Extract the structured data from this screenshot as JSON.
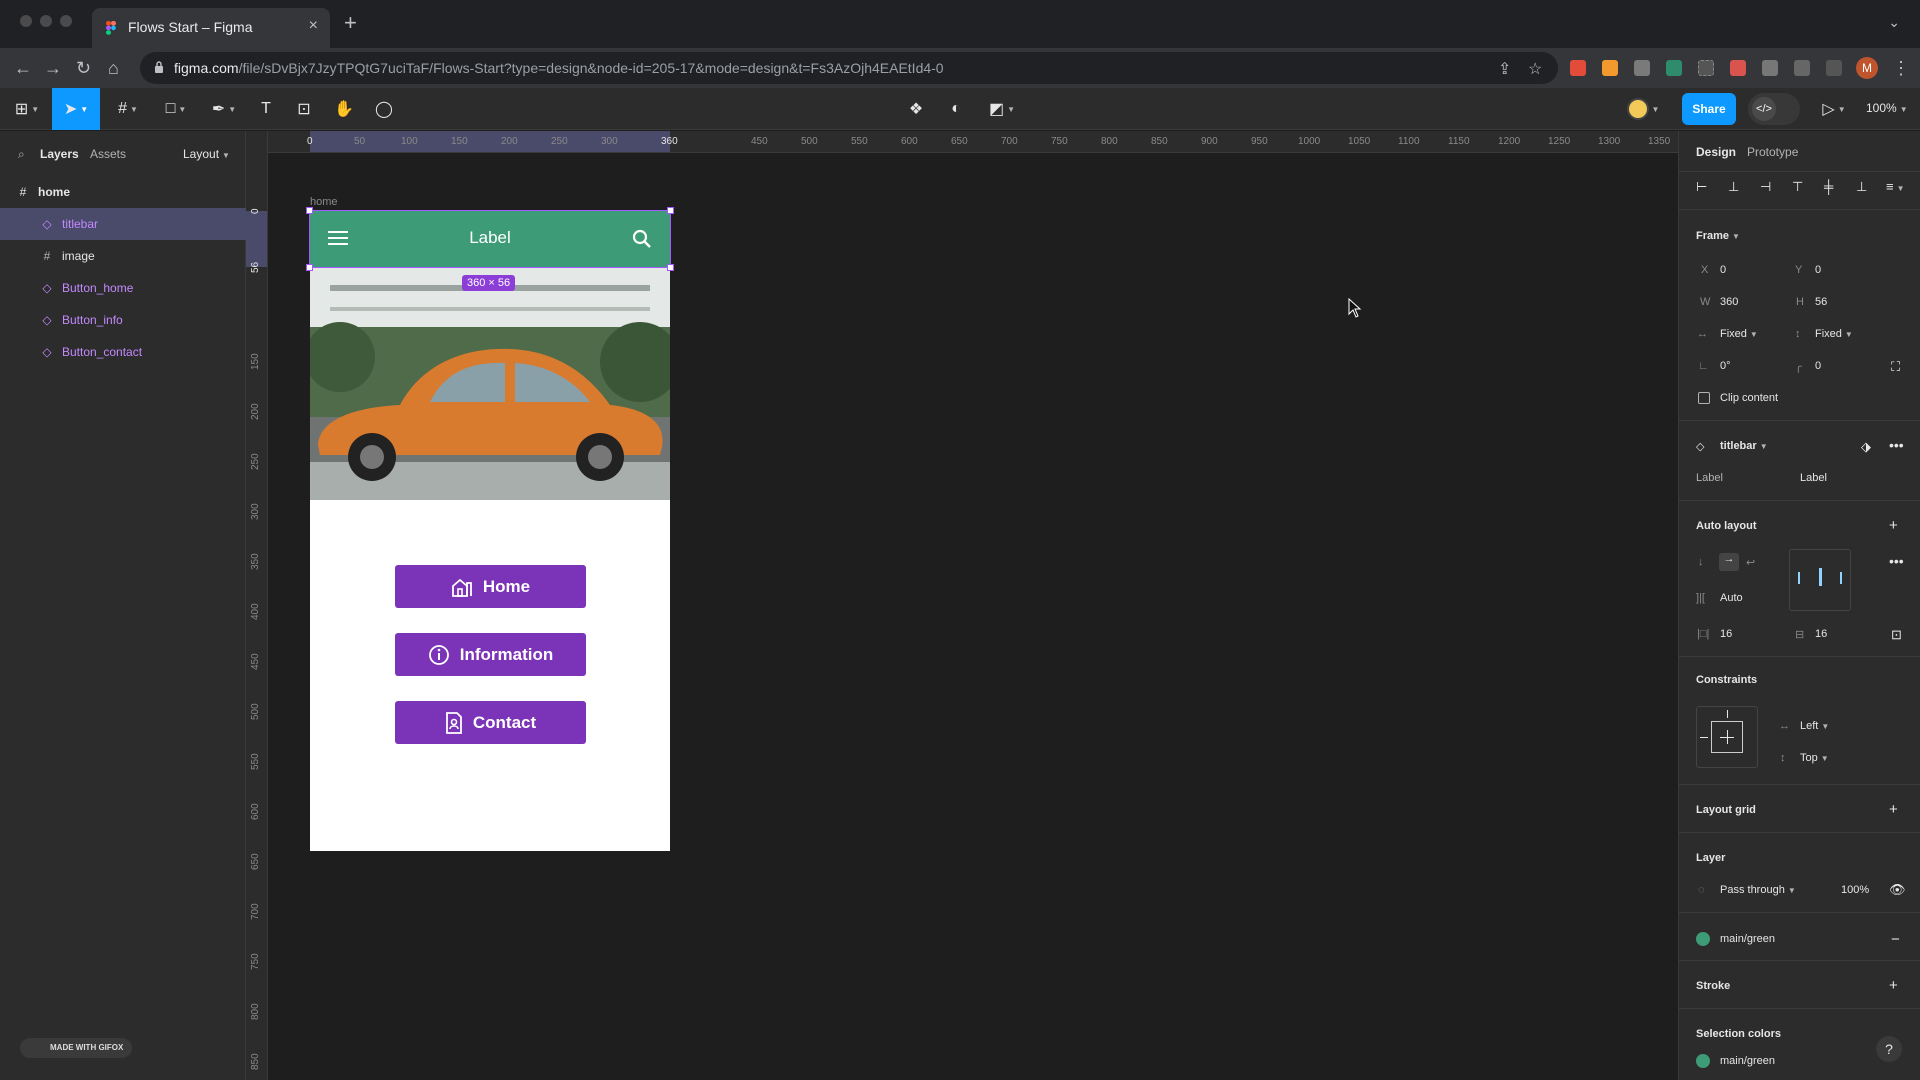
{
  "browser": {
    "tab_title": "Flows Start – Figma",
    "url_host": "figma.com",
    "url_path": "/file/sDvBjx7JzyTPQtG7uciTaF/Flows-Start?type=design&node-id=205-17&mode=design&t=Fs3AzOjh4EAEtId4-0",
    "profile_initial": "M"
  },
  "toolbar": {
    "share_label": "Share",
    "zoom_label": "100%",
    "devmode_label": "</>"
  },
  "left_panel": {
    "tab_layers": "Layers",
    "tab_assets": "Assets",
    "layout_label": "Layout",
    "layers": [
      {
        "name": "home",
        "type": "frame"
      },
      {
        "name": "titlebar",
        "type": "component"
      },
      {
        "name": "image",
        "type": "frame"
      },
      {
        "name": "Button_home",
        "type": "component"
      },
      {
        "name": "Button_info",
        "type": "component"
      },
      {
        "name": "Button_contact",
        "type": "component"
      }
    ],
    "gifox_label": "MADE WITH GIFOX"
  },
  "rulers": {
    "h_ticks": [
      "0",
      "50",
      "100",
      "150",
      "200",
      "250",
      "300",
      "360",
      "450",
      "500",
      "550",
      "600",
      "650",
      "700",
      "750",
      "800",
      "850",
      "900",
      "950",
      "1000",
      "1050",
      "1100",
      "1150",
      "1200",
      "1250",
      "1300",
      "1350"
    ],
    "v_ticks": [
      "0",
      "56",
      "150",
      "200",
      "250",
      "300",
      "350",
      "400",
      "450",
      "500",
      "550",
      "600",
      "650",
      "700",
      "750",
      "800",
      "850"
    ]
  },
  "canvas": {
    "frame_name": "home",
    "titlebar_label": "Label",
    "selection_size": "360 × 56",
    "buttons": {
      "home": "Home",
      "info": "Information",
      "contact": "Contact"
    }
  },
  "right_panel": {
    "tab_design": "Design",
    "tab_prototype": "Prototype",
    "frame_heading": "Frame",
    "x_label": "X",
    "x_value": "0",
    "y_label": "Y",
    "y_value": "0",
    "w_label": "W",
    "w_value": "360",
    "h_label": "H",
    "h_value": "56",
    "w_sizing": "Fixed",
    "h_sizing": "Fixed",
    "rotation": "0°",
    "radius": "0",
    "clip_content": "Clip content",
    "component_name": "titlebar",
    "prop_label": "Label",
    "prop_value": "Label",
    "auto_layout": "Auto layout",
    "auto_spacing": "Auto",
    "padding_h": "16",
    "padding_v": "16",
    "constraints": "Constraints",
    "constraint_h": "Left",
    "constraint_v": "Top",
    "layout_grid": "Layout grid",
    "layer_heading": "Layer",
    "blend_mode": "Pass through",
    "opacity": "100%",
    "fill_name": "main/green",
    "stroke": "Stroke",
    "selection_colors": "Selection colors",
    "selection_color_name": "main/green"
  },
  "colors": {
    "accent": "#0d99ff",
    "titlebar_green": "#3d9b78",
    "button_purple": "#7b33b7",
    "selection": "#a259ff"
  }
}
